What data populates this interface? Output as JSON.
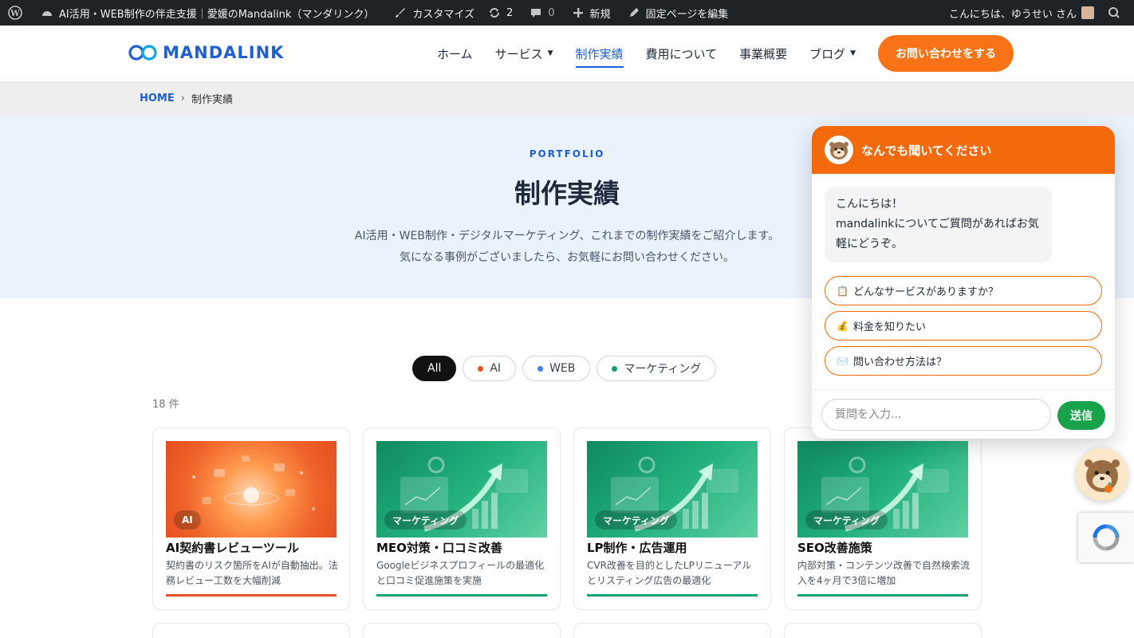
{
  "adminbar": {
    "site_title": "AI活用・WEB制作の伴走支援｜愛媛のMandalink（マンダリンク）",
    "customize": "カスタマイズ",
    "updates": "2",
    "comments": "0",
    "new": "新規",
    "edit_page": "固定ページを編集",
    "greeting": "こんにちは、ゆうせい さん"
  },
  "header": {
    "logo_text": "MANDALINK",
    "nav": [
      "ホーム",
      "サービス",
      "制作実績",
      "費用について",
      "事業概要",
      "ブログ"
    ],
    "cta": "お問い合わせをする"
  },
  "breadcrumb": {
    "home": "HOME",
    "sep": "›",
    "current": "制作実績"
  },
  "hero": {
    "eyebrow": "PORTFOLIO",
    "title": "制作実績",
    "desc1": "AI活用・WEB制作・デジタルマーケティング、これまでの制作実績をご紹介します。",
    "desc2": "気になる事例がございましたら、お気軽にお問い合わせください。"
  },
  "filters": [
    {
      "label": "All"
    },
    {
      "label": "AI",
      "color": "#e8532b"
    },
    {
      "label": "WEB",
      "color": "#3b82f6"
    },
    {
      "label": "マーケティング",
      "color": "#10a36b"
    }
  ],
  "count": "18 件",
  "cards": [
    {
      "badge": "AI",
      "title": "AI契約書レビューツール",
      "desc": "契約書のリスク箇所をAIが自動抽出。法務レビュー工数を大幅削減",
      "accent": "#e8532b"
    },
    {
      "badge": "マーケティング",
      "title": "MEO対策・口コミ改善",
      "desc": "Googleビジネスプロフィールの最適化と口コミ促進施策を実施",
      "accent": "#10a36b"
    },
    {
      "badge": "マーケティング",
      "title": "LP制作・広告運用",
      "desc": "CVR改善を目的としたLPリニューアルとリスティング広告の最適化",
      "accent": "#10a36b"
    },
    {
      "badge": "マーケティング",
      "title": "SEO改善施策",
      "desc": "内部対策・コンテンツ改善で自然検索流入を4ヶ月で3倍に増加",
      "accent": "#10a36b"
    }
  ],
  "chat": {
    "title": "なんでも聞いてください",
    "greeting1": "こんにちは！",
    "greeting2": "mandalinkについてご質問があればお気軽にどうぞ。",
    "quick": [
      {
        "icon": "📋",
        "label": "どんなサービスがありますか？"
      },
      {
        "icon": "💰",
        "label": "料金を知りたい"
      },
      {
        "icon": "✉️",
        "label": "問い合わせ方法は？"
      }
    ],
    "placeholder": "質問を入力...",
    "send": "送信"
  },
  "colors": {
    "brand": "#1f5fd6",
    "cta": "#f97316",
    "chat": "#f26a0c",
    "send": "#16a34a"
  }
}
